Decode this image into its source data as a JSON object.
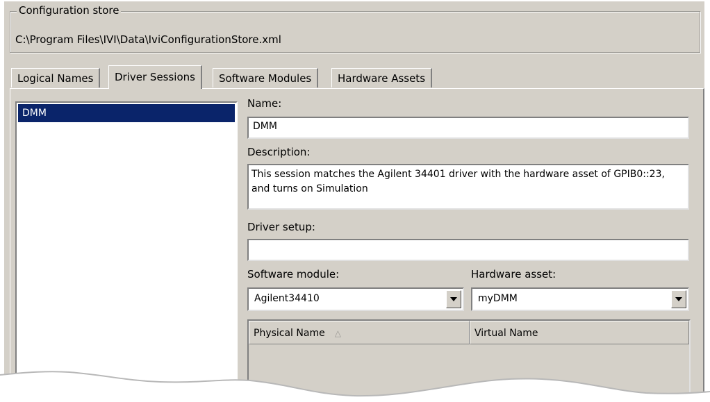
{
  "config_store": {
    "legend": "Configuration store",
    "path": "C:\\Program Files\\IVI\\Data\\IviConfigurationStore.xml"
  },
  "tabs": [
    {
      "label": "Logical Names",
      "active": false
    },
    {
      "label": "Driver Sessions",
      "active": true
    },
    {
      "label": "Software Modules",
      "active": false
    },
    {
      "label": "Hardware Assets",
      "active": false
    }
  ],
  "session_list": {
    "items": [
      "DMM"
    ],
    "selected": "DMM"
  },
  "form": {
    "name_label": "Name:",
    "name_value": "DMM",
    "description_label": "Description:",
    "description_value": "This session matches the Agilent 34401 driver with the hardware asset of GPIB0::23, and turns on Simulation",
    "driver_setup_label": "Driver setup:",
    "driver_setup_value": "",
    "software_module_label": "Software module:",
    "software_module_value": "Agilent34410",
    "hardware_asset_label": "Hardware asset:",
    "hardware_asset_value": "myDMM"
  },
  "names_table": {
    "columns": [
      "Physical Name",
      "Virtual Name"
    ],
    "rows": []
  },
  "colors": {
    "window_bg": "#d4d0c8",
    "selection": "#0a246a"
  }
}
